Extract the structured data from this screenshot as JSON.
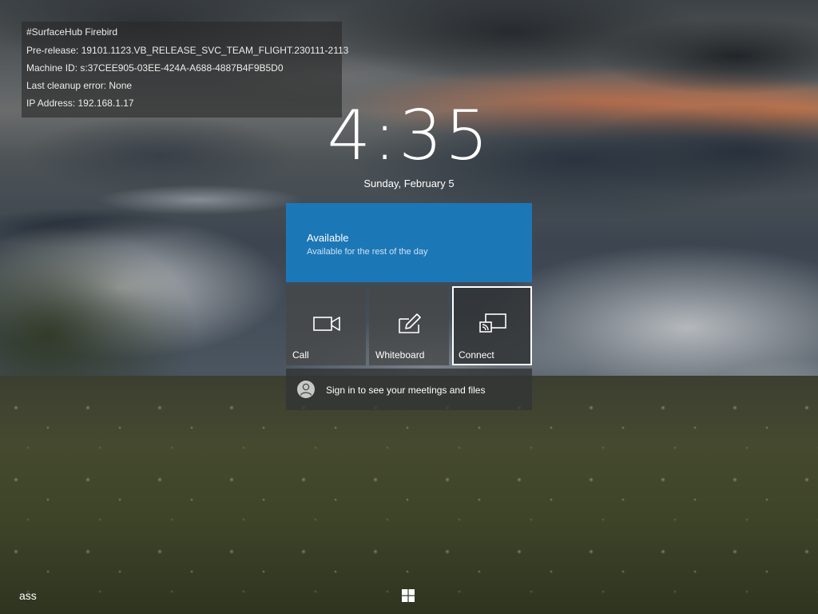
{
  "device_info": {
    "name": "#SurfaceHub Firebird",
    "prerelease": "Pre-release: 19101.1123.VB_RELEASE_SVC_TEAM_FLIGHT.230111-2113",
    "machine_id": "Machine ID: s:37CEE905-03EE-424A-A688-4887B4F9B5D0",
    "cleanup_error": "Last cleanup error: None",
    "ip_address": "IP Address: 192.168.1.17"
  },
  "clock": {
    "time": "4:35",
    "date": "Sunday, February 5"
  },
  "status": {
    "title": "Available",
    "subtitle": "Available for the rest of the day",
    "color": "#187cc2"
  },
  "actions": [
    {
      "label": "Call",
      "icon": "video-camera-icon"
    },
    {
      "label": "Whiteboard",
      "icon": "pen-on-board-icon"
    },
    {
      "label": "Connect",
      "icon": "screen-cast-icon",
      "selected": true
    }
  ],
  "signin": {
    "text": "Sign in to see your meetings and files",
    "icon": "person-avatar-icon"
  },
  "taskbar": {
    "language": "ass",
    "start_icon": "windows-logo-icon"
  }
}
